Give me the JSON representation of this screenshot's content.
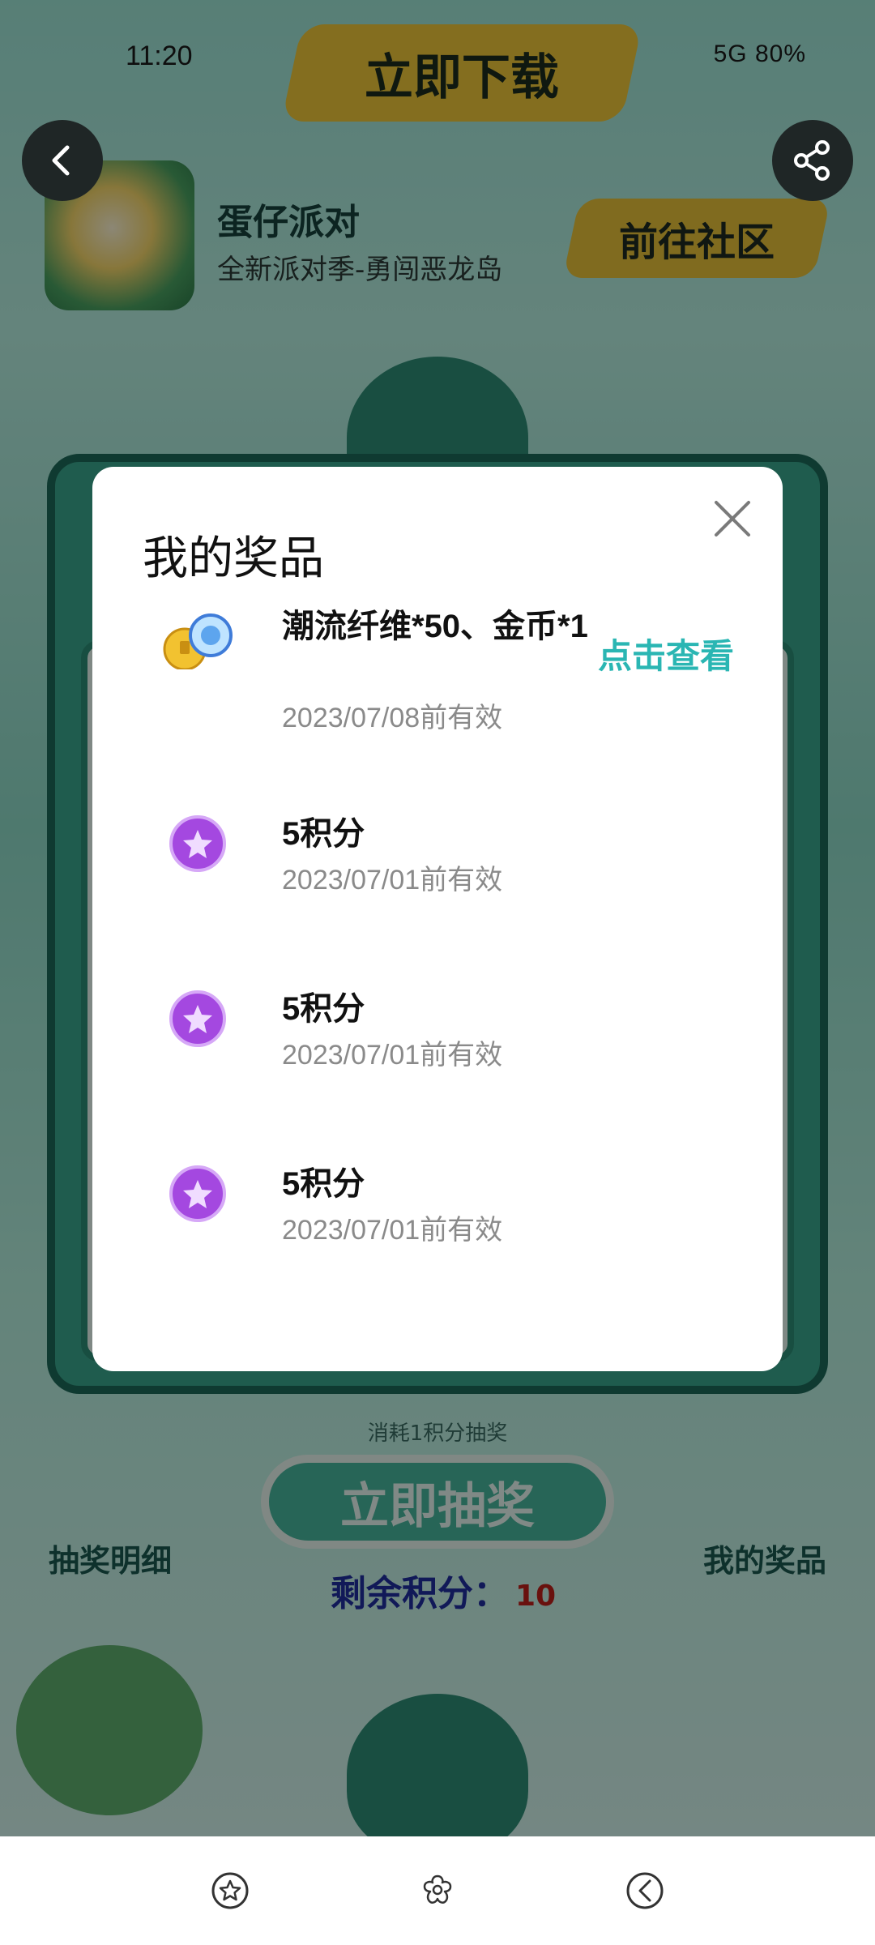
{
  "status_bar": {
    "time": "11:20",
    "right": "5G  80%"
  },
  "top": {
    "download_label": "立即下载",
    "app_name": "蛋仔派对",
    "app_subtitle": "全新派对季-勇闯恶龙岛",
    "community_label": "前往社区"
  },
  "page": {
    "cost_text": "消耗1积分抽奖",
    "draw_label": "立即抽奖",
    "lottery_detail_label": "抽奖明细",
    "my_prizes_label": "我的奖品",
    "remaining_points_label": "剩余积分：",
    "remaining_points_value": "10"
  },
  "modal": {
    "title": "我的奖品",
    "items": [
      {
        "name": "潮流纤维*50、金币*1",
        "date": "2023/07/08前有效",
        "action": "点击查看",
        "icon": "coin-gem-icon"
      },
      {
        "name": "5积分",
        "date": "2023/07/01前有效",
        "action": "",
        "icon": "star-points-icon"
      },
      {
        "name": "5积分",
        "date": "2023/07/01前有效",
        "action": "",
        "icon": "star-points-icon"
      },
      {
        "name": "5积分",
        "date": "2023/07/01前有效",
        "action": "",
        "icon": "star-points-icon"
      }
    ]
  },
  "nav": {
    "icons": [
      "star-icon",
      "flower-icon",
      "back-circle-icon"
    ]
  },
  "colors": {
    "accent": "#2ab6b3",
    "points_value": "#c0201a",
    "points_label": "#1f2fa0"
  }
}
